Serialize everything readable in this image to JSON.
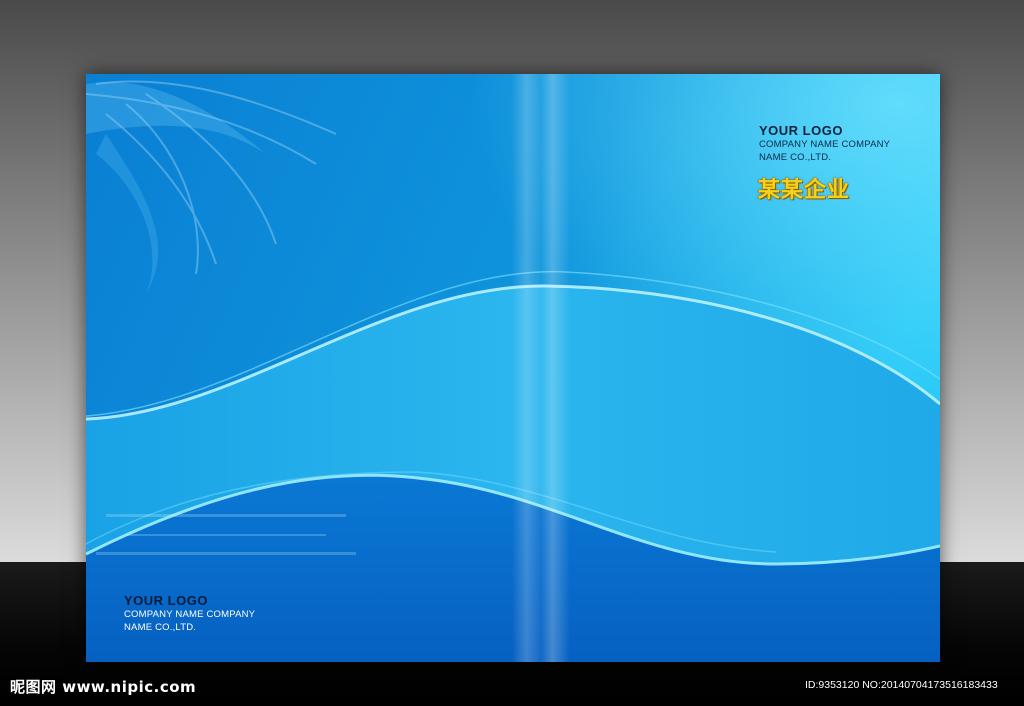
{
  "front_cover": {
    "logo_title": "YOUR LOGO",
    "logo_line1": "COMPANY NAME COMPANY",
    "logo_line2": "NAME CO.,LTD.",
    "company_name": "某某企业"
  },
  "back_cover": {
    "logo_title": "YOUR LOGO",
    "logo_line1": "COMPANY NAME COMPANY",
    "logo_line2": "NAME CO.,LTD."
  },
  "watermark": {
    "site": "昵图网 www.nipic.com",
    "id_text": "ID:9353120 NO:20140704173516183433"
  },
  "colors": {
    "cover_blue": "#0b86d6",
    "light_blue": "#3fc6f5",
    "dark_blue": "#0660c2",
    "gold": "#f4d21a"
  }
}
